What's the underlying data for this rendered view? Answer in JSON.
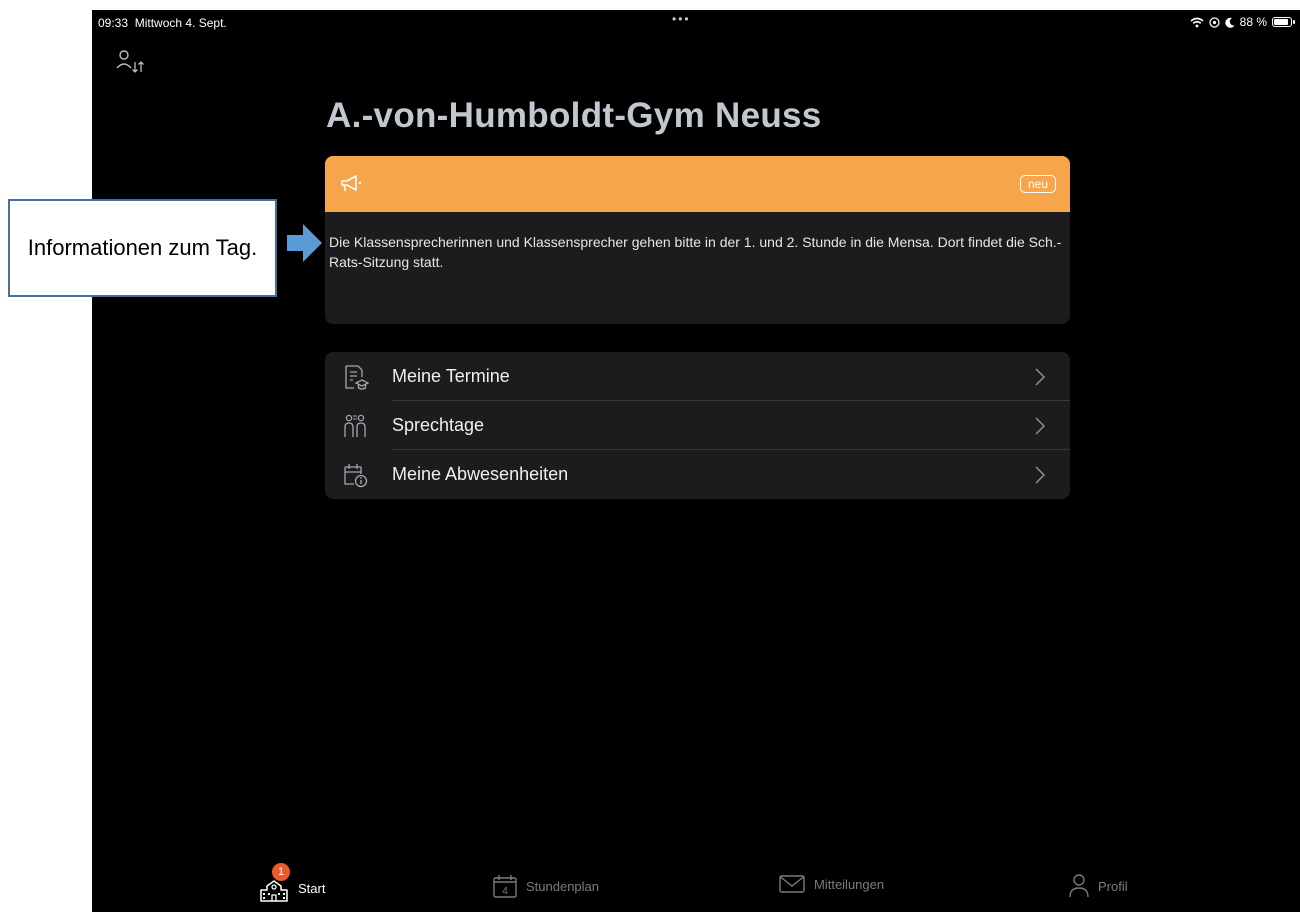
{
  "status_bar": {
    "time": "09:33",
    "date": "Mittwoch 4. Sept.",
    "multitask_dots": "•••",
    "battery": "88 %",
    "battery_level": 0.88
  },
  "school_name": "A.-von-Humboldt-Gym Neuss",
  "announcement": {
    "badge": "neu",
    "text": "Die Klassensprecherinnen und Klassensprecher gehen bitte in der 1. und 2. Stunde in die Mensa. Dort findet die Sch.-Rats-Sitzung statt.",
    "header_color": "#f6a54a"
  },
  "menu": {
    "items": [
      {
        "label": "Meine Termine",
        "icon": "appointments-icon"
      },
      {
        "label": "Sprechtage",
        "icon": "consultation-days-icon"
      },
      {
        "label": "Meine Abwesenheiten",
        "icon": "absences-icon"
      }
    ]
  },
  "tabs": {
    "start": {
      "label": "Start",
      "badge": "1",
      "icon": "school-icon"
    },
    "stundenplan": {
      "label": "Stundenplan",
      "icon": "calendar-icon",
      "icon_day": "4"
    },
    "mitteilungen": {
      "label": "Mitteilungen",
      "icon": "envelope-icon"
    },
    "profil": {
      "label": "Profil",
      "icon": "person-icon"
    }
  },
  "callout": {
    "text": "Informationen zum Tag.",
    "border_color": "#41719c",
    "arrow_color": "#5b9bd5"
  }
}
